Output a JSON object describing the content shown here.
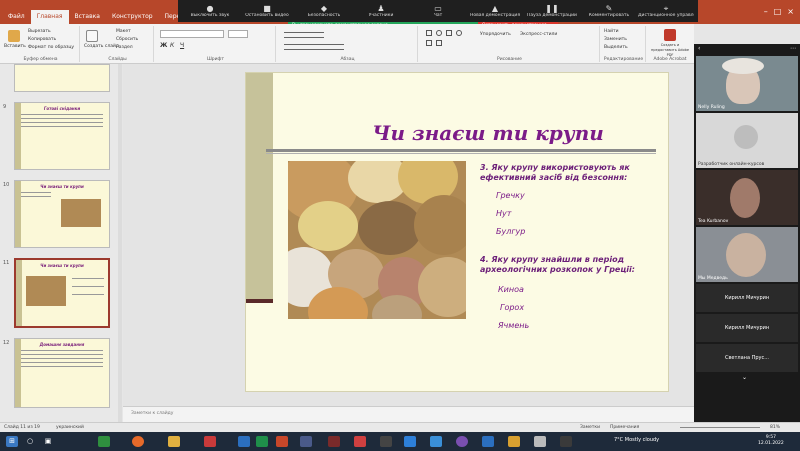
{
  "ribbon_tabs": [
    "Файл",
    "Главная",
    "Вставка",
    "Конструктор",
    "Переходы"
  ],
  "active_tab_index": 1,
  "zoom_toolbar": [
    {
      "icon": "mic-icon",
      "glyph": "🎤",
      "label": "Выключить звук"
    },
    {
      "icon": "video-icon",
      "glyph": "📹",
      "label": "Остановить видео"
    },
    {
      "icon": "shield-icon",
      "glyph": "🛡",
      "label": "Безопасность"
    },
    {
      "icon": "participants-icon",
      "glyph": "👥",
      "label": "Участники"
    },
    {
      "icon": "chat-icon",
      "glyph": "💬",
      "label": "Чат"
    },
    {
      "icon": "share-icon",
      "glyph": "⬆",
      "label": "Новая демонстрация"
    },
    {
      "icon": "pause-icon",
      "glyph": "⏸",
      "label": "Пауза демонстрации"
    },
    {
      "icon": "annotate-icon",
      "glyph": "✎",
      "label": "Комментировать"
    },
    {
      "icon": "remote-icon",
      "glyph": "🖱",
      "label": "Дистанционное управление"
    }
  ],
  "sharing_banner": "Вы транслируете демонстрацию экрана",
  "stop_share_label": "Остановить демонстрацию",
  "ribbon_group_names": {
    "clipboard": "Буфер обмена",
    "slides": "Слайды",
    "font": "Шрифт",
    "paragraph": "Абзац",
    "drawing": "Рисование",
    "editing": "Редактирование",
    "addin": "Adobe Acrobat"
  },
  "ribbon_buttons": {
    "paste": "Вставить",
    "cut": "Вырезать",
    "copy": "Копировать",
    "format_painter": "Формат по образцу",
    "new_slide": "Создать слайд",
    "layout": "Макет",
    "reset": "Сбросить",
    "section": "Раздел",
    "arrange": "Упорядочить",
    "quick_styles": "Экспресс-стили",
    "find": "Найти",
    "replace": "Заменить",
    "select": "Выделить",
    "pdf": "Создать и предоставить Adobe PDF"
  },
  "thumbnails": [
    {
      "num": "9",
      "title": "Готові сніданки"
    },
    {
      "num": "10",
      "title": "Чи знаєш ти крупи"
    },
    {
      "num": "11",
      "title": "Чи знаєш ти крупи"
    },
    {
      "num": "12",
      "title": "Домашнє завдання"
    }
  ],
  "selected_thumbnail": "11",
  "slide": {
    "title": "Чи знаєш ти крупи",
    "q1": "3. Яку крупу використовують як ефективний засіб від безсоння:",
    "q1_answers": [
      "Гречку",
      "Нут",
      "Булгур"
    ],
    "q2": "4. Яку крупу знайшли в період археологічних розкопок у Греції:",
    "q2_answers": [
      "Киноа",
      "Горох",
      "Ячмень"
    ]
  },
  "notes_placeholder": "Заметки к слайду",
  "participants": [
    {
      "name": "Nelly Ruling"
    },
    {
      "name": "Разработчик онлайн-курсов"
    },
    {
      "name": "Tea Kurbanov"
    },
    {
      "name": "Мы Медведь"
    }
  ],
  "name_tiles": [
    "Кирилл Мичурин",
    "Кирилл Мичурин",
    "Светлана Прус..."
  ],
  "status_bar": {
    "slide_counter": "Слайд 11 из 19",
    "language": "украинский",
    "notes_label": "Заметки",
    "comments_label": "Примечания",
    "zoom": "81%"
  },
  "taskbar": {
    "weather": "7°C Mostly cloudy",
    "time": "9:57",
    "date": "12.01.2022"
  },
  "colors": {
    "ppt_accent": "#b7472a",
    "title_purple": "#7b1b88",
    "slide_bg": "#fcfbe4"
  }
}
